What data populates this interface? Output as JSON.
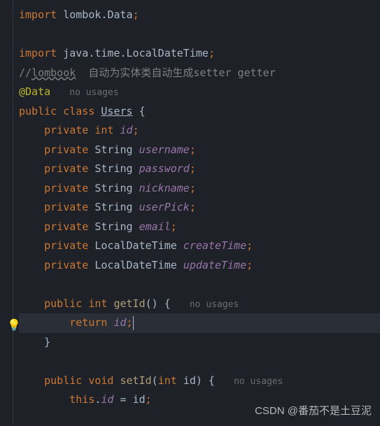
{
  "lines": {
    "l1": {
      "import": "import",
      "pkg": " lombok",
      "dot": ".",
      "cls": "Data",
      "semi": ";"
    },
    "l3": {
      "import": "import",
      "pkg": " java",
      "d1": ".",
      "p2": "time",
      "d2": ".",
      "cls": "LocalDateTime",
      "semi": ";"
    },
    "l4": {
      "slash": "//",
      "link": "lombook",
      "rest": "  自动为实体类自动生成setter getter"
    },
    "l5": {
      "ann": "@Data",
      "hint": "no usages"
    },
    "l6": {
      "pub": "public",
      "cls": "class",
      "name": "Users",
      "brace": " {"
    },
    "l7": {
      "priv": "private",
      "type": "int",
      "field": "id",
      "semi": ";"
    },
    "l8": {
      "priv": "private",
      "type": "String",
      "field": "username",
      "semi": ";"
    },
    "l9": {
      "priv": "private",
      "type": "String",
      "field": "password",
      "semi": ";"
    },
    "l10": {
      "priv": "private",
      "type": "String",
      "field": "nickname",
      "semi": ";"
    },
    "l11": {
      "priv": "private",
      "type": "String",
      "field": "userPick",
      "semi": ";"
    },
    "l12": {
      "priv": "private",
      "type": "String",
      "field": "email",
      "semi": ";"
    },
    "l13": {
      "priv": "private",
      "type": "LocalDateTime",
      "field": "createTime",
      "semi": ";"
    },
    "l14": {
      "priv": "private",
      "type": "LocalDateTime",
      "field": "updateTime",
      "semi": ";"
    },
    "l16": {
      "pub": "public",
      "type": "int",
      "method": "getId",
      "paren": "()",
      " brace": " {",
      "hint": "no usages"
    },
    "l17": {
      "ret": "return",
      "field": "id",
      "semi": ";"
    },
    "l18": {
      "brace": "}"
    },
    "l20": {
      "pub": "public",
      "type": "void",
      "method": "setId",
      "lp": "(",
      "ptype": "int",
      "pname": "id",
      "rp": ")",
      "brace": " {",
      "hint": "no usages"
    },
    "l21": {
      "this": "this",
      "dot": ".",
      "field": "id",
      "eq": " = ",
      "param": "id",
      "semi": ";"
    }
  },
  "watermark": "CSDN @番茄不是土豆泥",
  "bulb": "💡"
}
